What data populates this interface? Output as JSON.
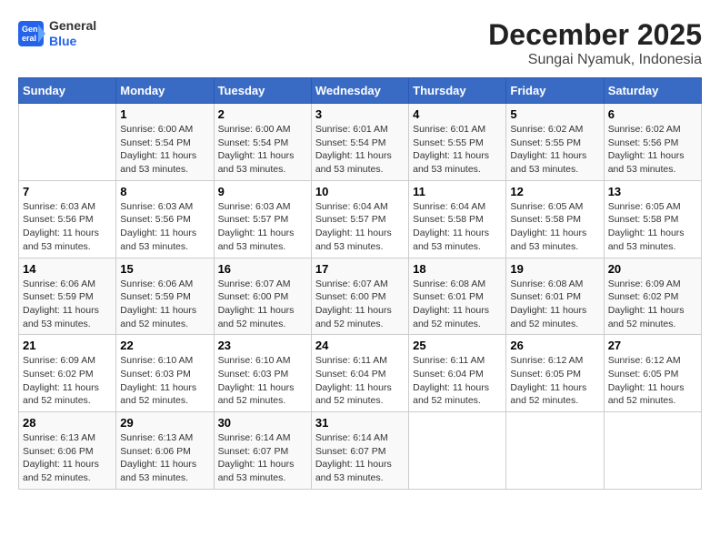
{
  "logo": {
    "line1": "General",
    "line2": "Blue"
  },
  "title": "December 2025",
  "subtitle": "Sungai Nyamuk, Indonesia",
  "days_of_week": [
    "Sunday",
    "Monday",
    "Tuesday",
    "Wednesday",
    "Thursday",
    "Friday",
    "Saturday"
  ],
  "weeks": [
    [
      {
        "day": "",
        "info": ""
      },
      {
        "day": "1",
        "info": "Sunrise: 6:00 AM\nSunset: 5:54 PM\nDaylight: 11 hours\nand 53 minutes."
      },
      {
        "day": "2",
        "info": "Sunrise: 6:00 AM\nSunset: 5:54 PM\nDaylight: 11 hours\nand 53 minutes."
      },
      {
        "day": "3",
        "info": "Sunrise: 6:01 AM\nSunset: 5:54 PM\nDaylight: 11 hours\nand 53 minutes."
      },
      {
        "day": "4",
        "info": "Sunrise: 6:01 AM\nSunset: 5:55 PM\nDaylight: 11 hours\nand 53 minutes."
      },
      {
        "day": "5",
        "info": "Sunrise: 6:02 AM\nSunset: 5:55 PM\nDaylight: 11 hours\nand 53 minutes."
      },
      {
        "day": "6",
        "info": "Sunrise: 6:02 AM\nSunset: 5:56 PM\nDaylight: 11 hours\nand 53 minutes."
      }
    ],
    [
      {
        "day": "7",
        "info": "Sunrise: 6:03 AM\nSunset: 5:56 PM\nDaylight: 11 hours\nand 53 minutes."
      },
      {
        "day": "8",
        "info": "Sunrise: 6:03 AM\nSunset: 5:56 PM\nDaylight: 11 hours\nand 53 minutes."
      },
      {
        "day": "9",
        "info": "Sunrise: 6:03 AM\nSunset: 5:57 PM\nDaylight: 11 hours\nand 53 minutes."
      },
      {
        "day": "10",
        "info": "Sunrise: 6:04 AM\nSunset: 5:57 PM\nDaylight: 11 hours\nand 53 minutes."
      },
      {
        "day": "11",
        "info": "Sunrise: 6:04 AM\nSunset: 5:58 PM\nDaylight: 11 hours\nand 53 minutes."
      },
      {
        "day": "12",
        "info": "Sunrise: 6:05 AM\nSunset: 5:58 PM\nDaylight: 11 hours\nand 53 minutes."
      },
      {
        "day": "13",
        "info": "Sunrise: 6:05 AM\nSunset: 5:58 PM\nDaylight: 11 hours\nand 53 minutes."
      }
    ],
    [
      {
        "day": "14",
        "info": "Sunrise: 6:06 AM\nSunset: 5:59 PM\nDaylight: 11 hours\nand 53 minutes."
      },
      {
        "day": "15",
        "info": "Sunrise: 6:06 AM\nSunset: 5:59 PM\nDaylight: 11 hours\nand 52 minutes."
      },
      {
        "day": "16",
        "info": "Sunrise: 6:07 AM\nSunset: 6:00 PM\nDaylight: 11 hours\nand 52 minutes."
      },
      {
        "day": "17",
        "info": "Sunrise: 6:07 AM\nSunset: 6:00 PM\nDaylight: 11 hours\nand 52 minutes."
      },
      {
        "day": "18",
        "info": "Sunrise: 6:08 AM\nSunset: 6:01 PM\nDaylight: 11 hours\nand 52 minutes."
      },
      {
        "day": "19",
        "info": "Sunrise: 6:08 AM\nSunset: 6:01 PM\nDaylight: 11 hours\nand 52 minutes."
      },
      {
        "day": "20",
        "info": "Sunrise: 6:09 AM\nSunset: 6:02 PM\nDaylight: 11 hours\nand 52 minutes."
      }
    ],
    [
      {
        "day": "21",
        "info": "Sunrise: 6:09 AM\nSunset: 6:02 PM\nDaylight: 11 hours\nand 52 minutes."
      },
      {
        "day": "22",
        "info": "Sunrise: 6:10 AM\nSunset: 6:03 PM\nDaylight: 11 hours\nand 52 minutes."
      },
      {
        "day": "23",
        "info": "Sunrise: 6:10 AM\nSunset: 6:03 PM\nDaylight: 11 hours\nand 52 minutes."
      },
      {
        "day": "24",
        "info": "Sunrise: 6:11 AM\nSunset: 6:04 PM\nDaylight: 11 hours\nand 52 minutes."
      },
      {
        "day": "25",
        "info": "Sunrise: 6:11 AM\nSunset: 6:04 PM\nDaylight: 11 hours\nand 52 minutes."
      },
      {
        "day": "26",
        "info": "Sunrise: 6:12 AM\nSunset: 6:05 PM\nDaylight: 11 hours\nand 52 minutes."
      },
      {
        "day": "27",
        "info": "Sunrise: 6:12 AM\nSunset: 6:05 PM\nDaylight: 11 hours\nand 52 minutes."
      }
    ],
    [
      {
        "day": "28",
        "info": "Sunrise: 6:13 AM\nSunset: 6:06 PM\nDaylight: 11 hours\nand 52 minutes."
      },
      {
        "day": "29",
        "info": "Sunrise: 6:13 AM\nSunset: 6:06 PM\nDaylight: 11 hours\nand 53 minutes."
      },
      {
        "day": "30",
        "info": "Sunrise: 6:14 AM\nSunset: 6:07 PM\nDaylight: 11 hours\nand 53 minutes."
      },
      {
        "day": "31",
        "info": "Sunrise: 6:14 AM\nSunset: 6:07 PM\nDaylight: 11 hours\nand 53 minutes."
      },
      {
        "day": "",
        "info": ""
      },
      {
        "day": "",
        "info": ""
      },
      {
        "day": "",
        "info": ""
      }
    ]
  ]
}
